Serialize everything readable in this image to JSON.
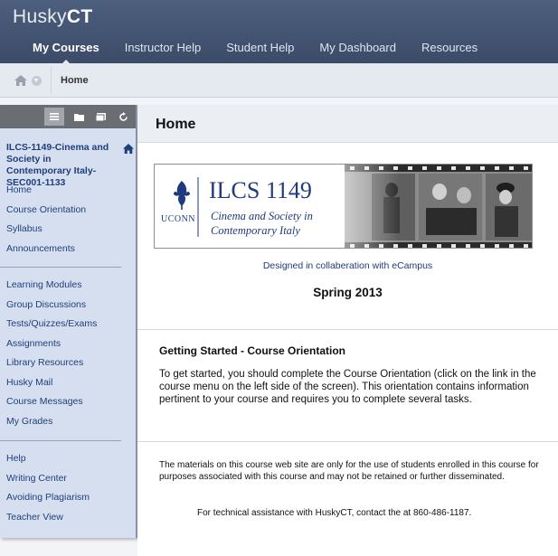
{
  "header": {
    "brand_part1": "Husky",
    "brand_part2": "CT",
    "tabs": [
      {
        "label": "My Courses"
      },
      {
        "label": "Instructor Help"
      },
      {
        "label": "Student Help"
      },
      {
        "label": "My Dashboard"
      },
      {
        "label": "Resources"
      }
    ]
  },
  "breadcrumb": {
    "current": "Home"
  },
  "sidebar": {
    "toolbar_icons": [
      "list-view-icon",
      "folder-view-icon",
      "window-icon",
      "refresh-icon"
    ],
    "course_title": "ILCS-1149-Cinema and Society in Contemporary Italy-SEC001-1133",
    "group1": [
      {
        "label": "Home"
      },
      {
        "label": "Course Orientation"
      },
      {
        "label": "Syllabus"
      },
      {
        "label": "Announcements"
      }
    ],
    "group2": [
      {
        "label": "Learning Modules"
      },
      {
        "label": "Group Discussions"
      },
      {
        "label": "Tests/Quizzes/Exams"
      },
      {
        "label": "Assignments"
      },
      {
        "label": "Library Resources"
      },
      {
        "label": "Husky Mail"
      },
      {
        "label": "Course Messages"
      },
      {
        "label": "My Grades"
      }
    ],
    "group3": [
      {
        "label": "Help"
      },
      {
        "label": "Writing Center"
      },
      {
        "label": "Avoiding Plagiarism"
      },
      {
        "label": "Teacher View"
      }
    ]
  },
  "content": {
    "page_title": "Home",
    "banner": {
      "logo_text": "UCONN",
      "course_code": "ILCS 1149",
      "subtitle_line1": "Cinema and Society in",
      "subtitle_line2": "Contemporary Italy"
    },
    "designed_by": "Designed in collaberation with eCampus",
    "term": "Spring 2013",
    "getting_started": {
      "title": "Getting Started - Course Orientation",
      "body": "To get started, you should complete the Course Orientation (click on the link in the course menu on the left side of the screen).  This orientation contains information pertinent to your course and requires you to complete several tasks."
    },
    "notice": "The materials on this course web site are only for the use of students enrolled in this course for purposes associated with this course and may not be retained or further disseminated.",
    "contact": "For technical assistance with HuskyCT, contact the  at 860-486-1187."
  },
  "colors": {
    "header_bg": "#3f4f6d",
    "sidebar_bg": "#d5dff0",
    "link": "#1f3f7a",
    "banner_title": "#1f3a7d"
  }
}
